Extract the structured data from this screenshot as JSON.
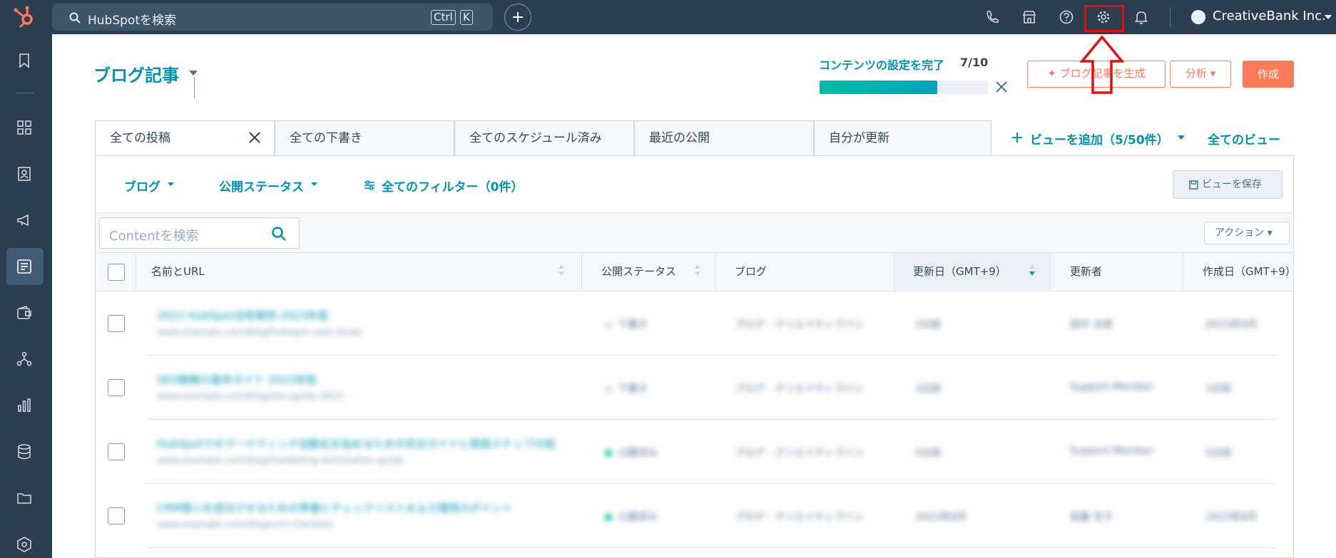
{
  "topbar": {
    "search_placeholder": "HubSpotを検索",
    "kbd_ctrl": "Ctrl",
    "kbd_k": "K",
    "account": "CreativeBank Inc.",
    "icons": [
      "phone-icon",
      "marketplace-icon",
      "help-icon",
      "gear-icon",
      "bell-icon"
    ]
  },
  "sidebar": {
    "icons": [
      "bookmark-icon",
      "grid-icon",
      "contacts-icon",
      "megaphone-icon",
      "content-icon",
      "commerce-icon",
      "automation-icon",
      "reports-icon",
      "data-icon",
      "folder-icon",
      "settings-hex-icon"
    ]
  },
  "page": {
    "title": "ブログ記事",
    "progress_label": "コンテンツの設定を完了",
    "progress_count": "7/10",
    "progress_fraction": 0.7,
    "generate_button": "ブログ記事を生成",
    "analyze_button": "分析",
    "create_button": "作成"
  },
  "tabs": [
    {
      "label": "全ての投稿",
      "active": true
    },
    {
      "label": "全ての下書き"
    },
    {
      "label": "全てのスケジュール済み"
    },
    {
      "label": "最近の公開"
    },
    {
      "label": "自分が更新"
    }
  ],
  "views": {
    "add_view": "ビューを追加（5/50件）",
    "all_views": "全てのビュー"
  },
  "filters": {
    "blog": "ブログ",
    "status": "公開ステータス",
    "all_filters": "全てのフィルター（0件）",
    "save_view": "ビューを保存"
  },
  "toolbar": {
    "search_placeholder": "Contentを検索",
    "actions": "アクション"
  },
  "columns": {
    "name": "名前とURL",
    "status": "公開ステータス",
    "blog": "ブログ",
    "updated": "更新日（GMT+9）",
    "updater": "更新者",
    "created": "作成日（GMT+9）"
  },
  "rows": [
    {
      "title": "2023 HubSpot活用事例 2023年度",
      "url": "www.example.com/blog/hubspot-case-study",
      "status": "下書き",
      "status_color": "#cbd6e2",
      "blog": "ブログ - クリエイティブバンク",
      "updated": "2日前",
      "updater": "田中 太郎",
      "created": "2023年9月"
    },
    {
      "title": "SEO戦略の基本ガイド 2023年版",
      "url": "www.example.com/blog/seo-guide-2023",
      "status": "下書き",
      "status_color": "#cbd6e2",
      "blog": "ブログ - クリエイティブバンク",
      "updated": "3日前",
      "updater": "Support Member",
      "created": "3日前"
    },
    {
      "title": "HubSpotでのマーケティング自動化を始めるための完全ガイドと実践ステップの紹介",
      "url": "www.example.com/blog/marketing-automation-guide",
      "status": "公開済み",
      "status_color": "#00bda5",
      "blog": "ブログ - クリエイティブバンク",
      "updated": "5日前",
      "updater": "Support Member",
      "created": "5日前"
    },
    {
      "title": "CRM導入を成功させるための準備とチェックリストおよび運用のポイント",
      "url": "www.example.com/blog/crm-checklist",
      "status": "公開済み",
      "status_color": "#00bda5",
      "blog": "ブログ - クリエイティブバンク",
      "updated": "2023年8月",
      "updater": "佐藤 花子",
      "created": "2023年8月"
    }
  ]
}
